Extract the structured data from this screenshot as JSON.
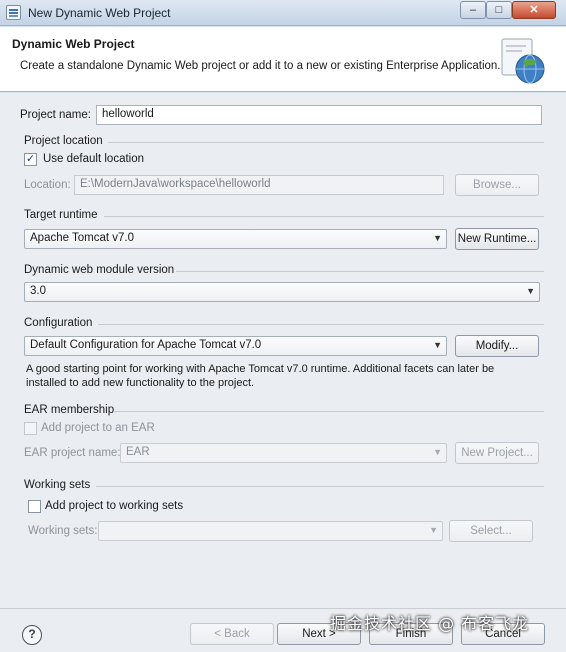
{
  "window": {
    "title": "New Dynamic Web Project",
    "min_label": "–",
    "max_label": "□",
    "close_label": "✕"
  },
  "banner": {
    "title": "Dynamic Web Project",
    "description": "Create a standalone Dynamic Web project or add it to a new or existing Enterprise Application."
  },
  "project_name": {
    "label": "Project name:",
    "value": "helloworld"
  },
  "project_location": {
    "group_label": "Project location",
    "use_default_label": "Use default location",
    "use_default_checked": true,
    "location_label": "Location:",
    "location_value": "E:\\ModernJava\\workspace\\helloworld",
    "browse_label": "Browse..."
  },
  "target_runtime": {
    "group_label": "Target runtime",
    "value": "Apache Tomcat v7.0",
    "new_runtime_label": "New Runtime..."
  },
  "module_version": {
    "group_label": "Dynamic web module version",
    "value": "3.0"
  },
  "configuration": {
    "group_label": "Configuration",
    "value": "Default Configuration for Apache Tomcat v7.0",
    "modify_label": "Modify...",
    "description_line1": "A good starting point for working with Apache Tomcat v7.0 runtime. Additional facets can later be",
    "description_line2": "installed to add new functionality to the project."
  },
  "ear": {
    "group_label": "EAR membership",
    "add_label": "Add project to an EAR",
    "add_checked": false,
    "project_name_label": "EAR project name:",
    "project_name_value": "EAR",
    "new_project_label": "New Project..."
  },
  "working_sets": {
    "group_label": "Working sets",
    "add_label": "Add project to working sets",
    "add_checked": false,
    "sets_label": "Working sets:",
    "sets_value": "",
    "select_label": "Select..."
  },
  "footer": {
    "help_label": "?",
    "back_label": "< Back",
    "next_label": "Next >",
    "finish_label": "Finish",
    "cancel_label": "Cancel",
    "watermark": "掘金技术社区 @ 布客飞龙"
  },
  "icons": {
    "dropdown_arrow": "▼",
    "checkmark": "✓"
  }
}
